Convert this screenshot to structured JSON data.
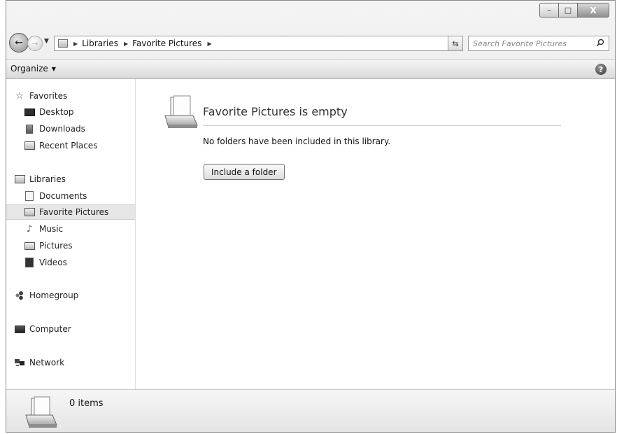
{
  "window": {
    "caption": {
      "minimize": "–",
      "maximize": "□",
      "close": "X"
    }
  },
  "navbar": {
    "back_glyph": "←",
    "forward_glyph": "→",
    "recent_glyph": "▼",
    "breadcrumb": [
      "Libraries",
      "Favorite Pictures"
    ],
    "crumb_sep": "▶",
    "address_dropdown_glyph": "▼",
    "refresh_glyph": "⇆",
    "search_placeholder": "Search Favorite Pictures",
    "search_icon": "search-icon"
  },
  "toolbar": {
    "organize_label": "Organize",
    "organize_caret": "▼",
    "help_glyph": "?"
  },
  "sidebar": {
    "favorites": {
      "label": "Favorites",
      "icon": "star-icon"
    },
    "favorites_items": [
      {
        "label": "Desktop",
        "icon": "desktop-icon"
      },
      {
        "label": "Downloads",
        "icon": "downloads-icon"
      },
      {
        "label": "Recent Places",
        "icon": "recent-places-icon"
      }
    ],
    "libraries": {
      "label": "Libraries",
      "icon": "libraries-icon"
    },
    "library_items": [
      {
        "label": "Documents",
        "icon": "documents-icon"
      },
      {
        "label": "Favorite Pictures",
        "icon": "library-icon",
        "selected": true
      },
      {
        "label": "Music",
        "icon": "music-icon"
      },
      {
        "label": "Pictures",
        "icon": "pictures-icon"
      },
      {
        "label": "Videos",
        "icon": "videos-icon"
      }
    ],
    "homegroup": {
      "label": "Homegroup",
      "icon": "homegroup-icon"
    },
    "computer": {
      "label": "Computer",
      "icon": "computer-icon"
    },
    "network": {
      "label": "Network",
      "icon": "network-icon"
    }
  },
  "content": {
    "title": "Favorite Pictures is empty",
    "message": "No folders have been included in this library.",
    "include_button": "Include a folder"
  },
  "status": {
    "items_text": "0 items"
  },
  "colors": {
    "chrome_light": "#f4f4f4",
    "chrome_dark": "#dcdcdc",
    "selection": "#e6e6e6"
  }
}
